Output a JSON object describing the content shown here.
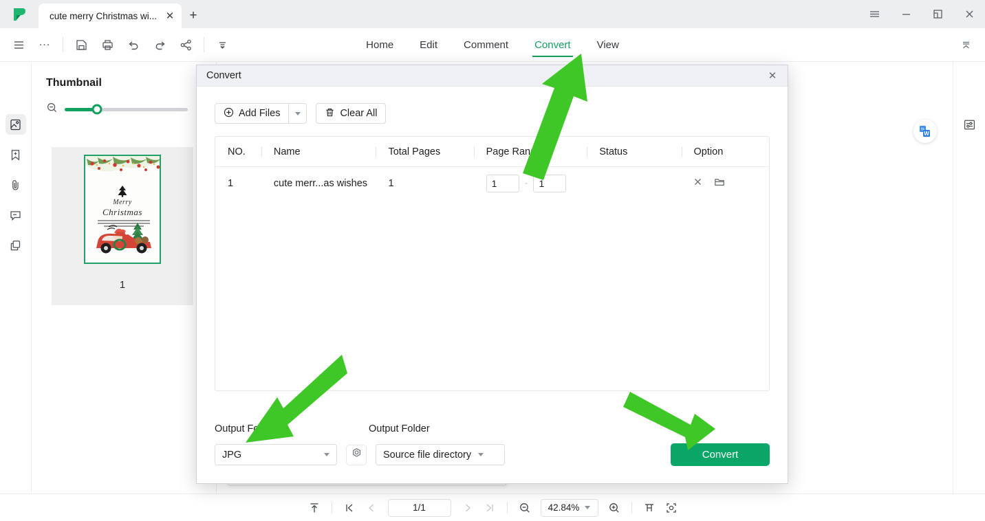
{
  "window": {
    "tab_title": "cute merry Christmas wi...",
    "new_tab_label": "+",
    "close_tab_label": "✕",
    "controls": {
      "menu": "☰",
      "minimize": "—",
      "restore": "❐",
      "close": "✕"
    }
  },
  "toolbar": {
    "icons": [
      "hamburger-icon",
      "more-icon",
      "save-icon",
      "print-icon",
      "undo-icon",
      "redo-icon",
      "share-icon",
      "more-tools-icon"
    ],
    "dots_label": "...",
    "collapse_ribbon": "collapse-ribbon-icon"
  },
  "menu": {
    "items": [
      {
        "label": "Home",
        "active": false
      },
      {
        "label": "Edit",
        "active": false
      },
      {
        "label": "Comment",
        "active": false
      },
      {
        "label": "Convert",
        "active": true
      },
      {
        "label": "View",
        "active": false
      }
    ]
  },
  "left_rail": {
    "items": [
      {
        "name": "thumbnail-panel-icon",
        "active": true
      },
      {
        "name": "bookmark-icon",
        "active": false
      },
      {
        "name": "attachment-icon",
        "active": false
      },
      {
        "name": "comment-icon",
        "active": false
      },
      {
        "name": "layers-icon",
        "active": false
      }
    ]
  },
  "thumbnail_panel": {
    "title": "Thumbnail",
    "collapse_label": "›",
    "zoom_out_icon": "zoom-out-icon",
    "zoom_in_icon": "zoom-in-icon",
    "slider_value": 26,
    "page_number": "1",
    "page_art": {
      "title_line1": "Merry",
      "title_line2": "Christmas"
    }
  },
  "right_rail": {
    "panel_icon": "properties-panel-icon",
    "float_button": "convert-to-word-icon"
  },
  "dialog": {
    "title": "Convert",
    "close_label": "✕",
    "add_files_label": "Add Files",
    "add_files_icon": "plus-circle-icon",
    "add_files_caret": "▾",
    "clear_all_label": "Clear All",
    "clear_all_icon": "trash-icon",
    "table": {
      "columns": [
        "NO.",
        "Name",
        "Total Pages",
        "Page Range",
        "Status",
        "Option"
      ],
      "rows": [
        {
          "no": "1",
          "name": "cute merr...as wishes",
          "total_pages": "1",
          "range_from": "1",
          "range_to": "1",
          "range_dash": "-",
          "status": "",
          "option_icons": [
            "remove-icon",
            "open-folder-icon"
          ]
        }
      ]
    },
    "output_format_label": "Output Format",
    "output_folder_label": "Output Folder",
    "output_format_value": "JPG",
    "output_format_caret": "▾",
    "settings_icon": "settings-gear-icon",
    "output_folder_value": "Source file directory",
    "output_folder_caret": "▾",
    "convert_button_label": "Convert"
  },
  "statusbar": {
    "fit_top_icon": "scroll-to-top-icon",
    "first_page_icon": "first-page-icon",
    "prev_page_icon": "previous-page-icon",
    "page_indicator": "1/1",
    "next_page_icon": "next-page-icon",
    "last_page_icon": "last-page-icon",
    "zoom_out_icon": "zoom-out-icon",
    "zoom_value": "42.84%",
    "zoom_caret": "▾",
    "zoom_in_icon": "zoom-in-icon",
    "fit_width_icon": "fit-width-icon",
    "fit_page_icon": "fit-page-icon"
  },
  "annotations": {
    "arrow_to_convert_tab": "green-arrow-up-right",
    "arrow_to_output_format": "green-arrow-down-left",
    "arrow_to_convert_button": "green-arrow-down-right",
    "color": "#3fc728"
  },
  "colors": {
    "accent_green": "#12a05e",
    "convert_button": "#0aa667",
    "annotation_green": "#3fc728"
  }
}
